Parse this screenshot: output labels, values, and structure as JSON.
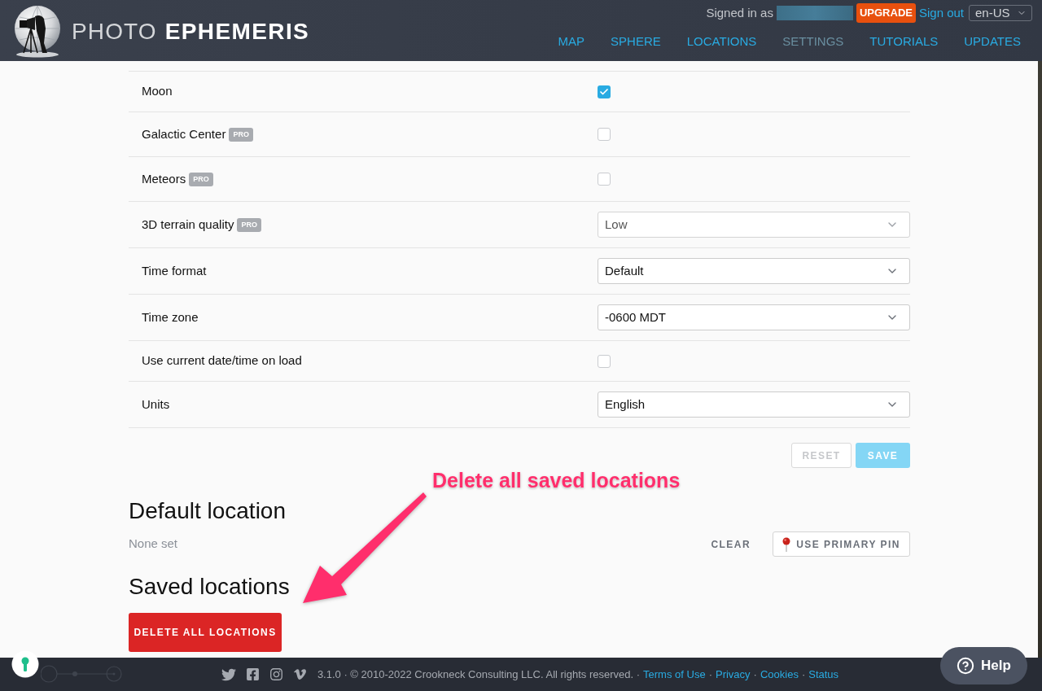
{
  "header": {
    "logo": {
      "light_text": "PHOTO",
      "bold_text": "EPHEMERIS"
    },
    "account": {
      "signed_in_label": "Signed in as",
      "upgrade_label": "UPGRADE",
      "sign_out_label": "Sign out",
      "language": "en-US"
    },
    "nav": [
      {
        "label": "MAP",
        "selected": false
      },
      {
        "label": "SPHERE",
        "selected": false
      },
      {
        "label": "LOCATIONS",
        "selected": false
      },
      {
        "label": "SETTINGS",
        "selected": true
      },
      {
        "label": "TUTORIALS",
        "selected": false
      },
      {
        "label": "UPDATES",
        "selected": false
      }
    ]
  },
  "settings": {
    "rows": [
      {
        "label": "Moon",
        "kind": "checkbox",
        "checked": true
      },
      {
        "label": "Galactic Center",
        "badge": "PRO",
        "kind": "checkbox",
        "checked": false
      },
      {
        "label": "Meteors",
        "badge": "PRO",
        "kind": "checkbox",
        "checked": false
      },
      {
        "label": "3D terrain quality",
        "badge": "PRO",
        "kind": "select",
        "value": "Low",
        "disabled": true
      },
      {
        "label": "Time format",
        "kind": "select",
        "value": "Default",
        "disabled": false
      },
      {
        "label": "Time zone",
        "kind": "select",
        "value": "-0600 MDT",
        "disabled": false
      },
      {
        "label": "Use current date/time on load",
        "kind": "checkbox",
        "checked": false
      },
      {
        "label": "Units",
        "kind": "select",
        "value": "English",
        "disabled": false
      }
    ],
    "buttons": [
      {
        "label": "RESET",
        "kind": "outline",
        "disabled": true
      },
      {
        "label": "SAVE",
        "kind": "primary",
        "disabled": true
      }
    ]
  },
  "annotation": {
    "text": "Delete all saved locations"
  },
  "default_location": {
    "title": "Default location",
    "value": "None set",
    "buttons": [
      {
        "label": "CLEAR",
        "kind": "plain"
      },
      {
        "label": "USE PRIMARY PIN",
        "kind": "pin"
      }
    ]
  },
  "saved_locations": {
    "title": "Saved locations",
    "button": "DELETE ALL LOCATIONS"
  },
  "footer": {
    "items": [
      {
        "kind": "text",
        "text": "3.1.0 · © 2010-2022 Crookneck Consulting LLC. All rights reserved. ·"
      },
      {
        "kind": "link",
        "text": "Terms of Use"
      },
      {
        "kind": "text",
        "text": "·"
      },
      {
        "kind": "link",
        "text": "Privacy"
      },
      {
        "kind": "text",
        "text": "·"
      },
      {
        "kind": "link",
        "text": "Cookies"
      },
      {
        "kind": "text",
        "text": "·"
      },
      {
        "kind": "link",
        "text": "Status"
      }
    ]
  },
  "help": {
    "label": "Help"
  }
}
